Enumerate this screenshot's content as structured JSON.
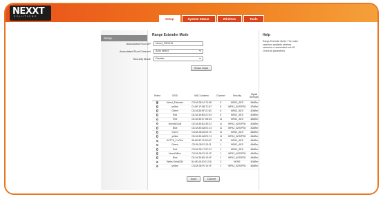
{
  "brand": {
    "logo": "NEXXT",
    "tagline": "SOLUTIONS"
  },
  "tabs": [
    {
      "label": "Setup",
      "active": true
    },
    {
      "label": "System Status",
      "active": false
    },
    {
      "label": "Wireless",
      "active": false
    },
    {
      "label": "Tools",
      "active": false
    }
  ],
  "sidebar": {
    "items": [
      {
        "label": "Setup"
      }
    ]
  },
  "main": {
    "title": "Range Extender Mode",
    "fields": {
      "ssid_label": "Associated Root AP",
      "ssid_value": "Nexxt_F5D215",
      "channel_label": "Associated Root Channel",
      "channel_value": "Auto select",
      "security_label": "Security Mode",
      "security_value": "Disable"
    },
    "show_scan": "Show Scan",
    "table": {
      "headers": [
        "Select",
        "SSID",
        "MAC Address",
        "Channel",
        "Security",
        "Signal Strength"
      ],
      "rows": [
        {
          "selected": true,
          "ssid": "Nexxt_Extender",
          "mac": "C8:3A:35:A1:74:68",
          "channel": "6",
          "security": "WPA2_AES",
          "signal": "-66dBm"
        },
        {
          "selected": false,
          "ssid": "yellow",
          "mac": "C4:6E:1F:5B:7C:87",
          "channel": "6",
          "security": "WPA2_AES/PSK",
          "signal": "-52dBm"
        },
        {
          "selected": false,
          "ssid": "Green",
          "mac": "C8:3A:35:5F:21:6C",
          "channel": "6",
          "security": "WPA2_AES",
          "signal": "-60dBm"
        },
        {
          "selected": false,
          "ssid": "Red",
          "mac": "C8:3A:35:B5:2C:94",
          "channel": "6",
          "security": "WPA2_AES",
          "signal": "-60dBm"
        },
        {
          "selected": false,
          "ssid": "Red",
          "mac": "C8:3A:35:57:4B:D4",
          "channel": "11",
          "security": "WPA2_AES",
          "signal": "-66dBm"
        },
        {
          "selected": false,
          "ssid": "NexxtWLAN",
          "mac": "C8:3A:35:B2:4E:22",
          "channel": "11",
          "security": "WPA2_AES/PSK",
          "signal": "-60dBm"
        },
        {
          "selected": false,
          "ssid": "Blue",
          "mac": "C8:3A:35:A8:E1:14",
          "channel": "11",
          "security": "WPA2_AES/PSK",
          "signal": "-60dBm"
        },
        {
          "selected": false,
          "ssid": "Green",
          "mac": "C8:3A:35:65:0E:70",
          "channel": "11",
          "security": "WPA2_AES",
          "signal": "-66dBm"
        },
        {
          "selected": false,
          "ssid": "yellow",
          "mac": "C8:3A:35:A8:E1:74",
          "channel": "11",
          "security": "WPA2_AES/PSK",
          "signal": "-66dBm"
        },
        {
          "selected": false,
          "ssid": "ACTT6_2.4GHz",
          "mac": "58:6D:8F:32:50:0C",
          "channel": "11",
          "security": "WPA2_AES",
          "signal": "-66dBm"
        },
        {
          "selected": false,
          "ssid": "Green",
          "mac": "C8:3A:35:F0:13:11",
          "channel": "1",
          "security": "WPA2_AES",
          "signal": "-66dBm"
        },
        {
          "selected": false,
          "ssid": "Red",
          "mac": "C8:3A:35:17:0F:F4",
          "channel": "1",
          "security": "WPA2_AES",
          "signal": "-66dBm"
        },
        {
          "selected": false,
          "ssid": "NexxtOffice",
          "mac": "C8:3A:35:F0:13:1F",
          "channel": "1",
          "security": "WPA2_AES/PSK",
          "signal": "-66dBm"
        },
        {
          "selected": false,
          "ssid": "Blue",
          "mac": "C8:3A:35:B5:1E:0F",
          "channel": "1",
          "security": "WPA2_AES/PSK",
          "signal": "-66dBm"
        },
        {
          "selected": false,
          "ssid": "Webs Serial334",
          "mac": "54:4E:45:20:E1:EA",
          "channel": "3",
          "security": "NONE",
          "signal": "-60dBm"
        },
        {
          "selected": false,
          "ssid": "yellow",
          "mac": "C8:3A:35:F0:13:1F",
          "channel": "1",
          "security": "WPA2_AES/PSK",
          "signal": "-66dBm"
        }
      ]
    },
    "save_label": "Save",
    "cancel_label": "Cancel"
  },
  "help": {
    "title": "Help",
    "text": "Range Extender Mode: The router searches available wireless networks or associated root AP. Check all parameters."
  },
  "colors": {
    "accent": "#e87722",
    "tab": "#d9441a",
    "sidebar_item": "#8a8a8a"
  }
}
